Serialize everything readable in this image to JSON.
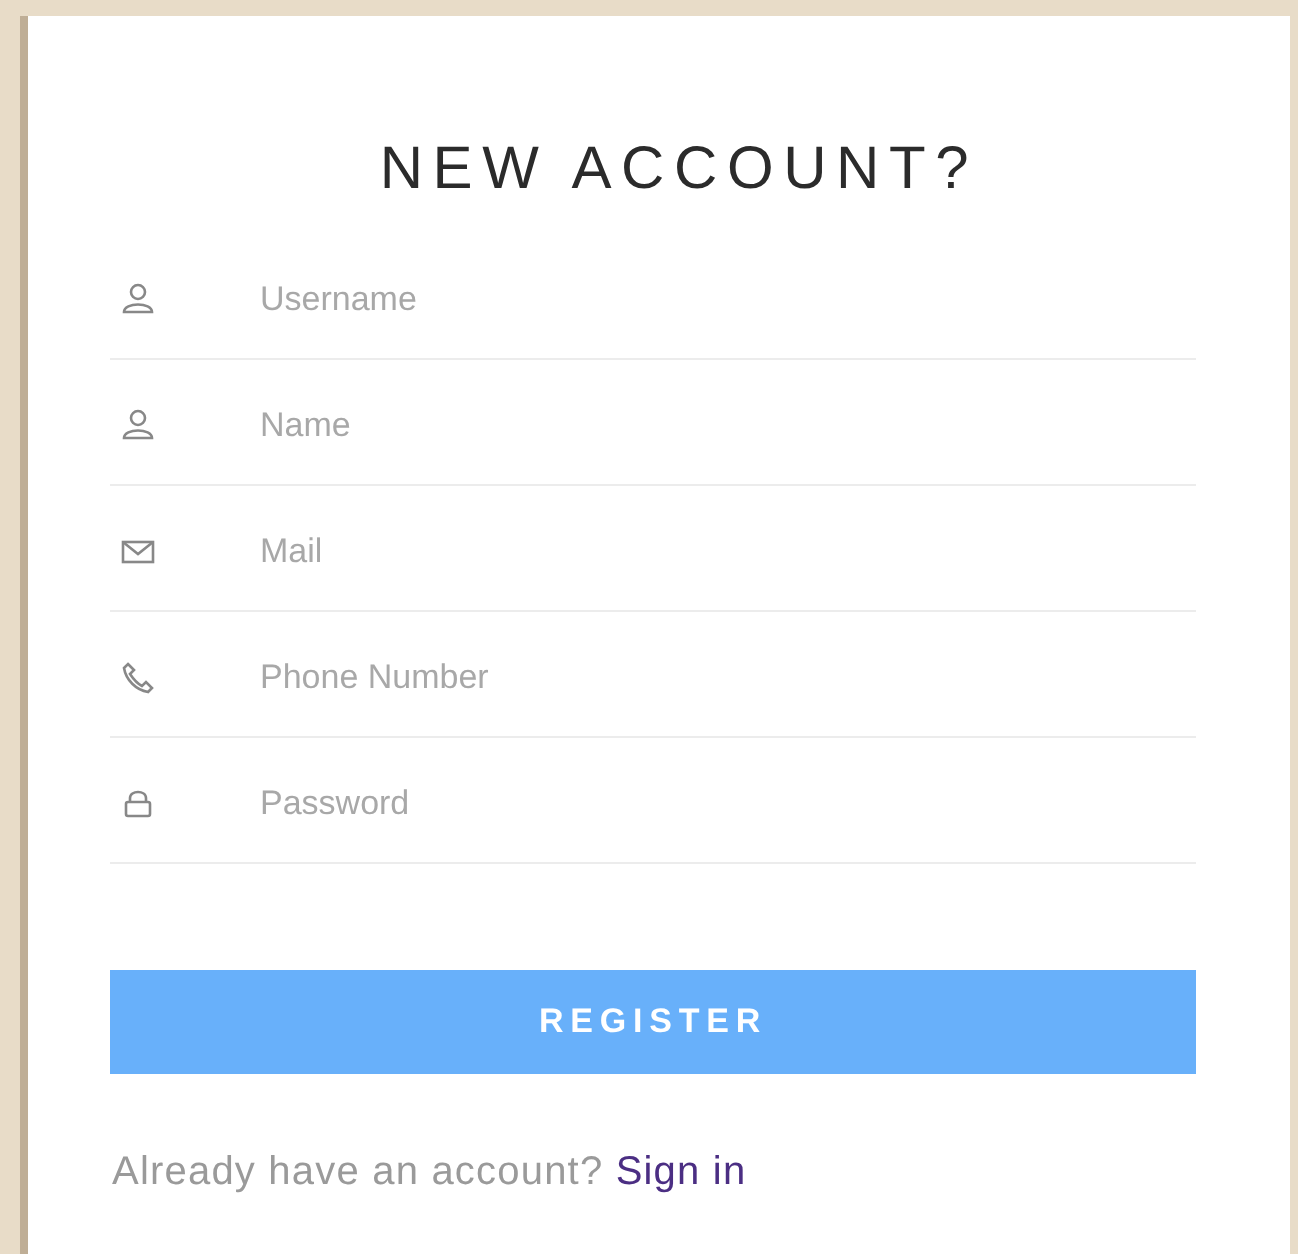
{
  "title": "NEW ACCOUNT?",
  "fields": [
    {
      "kind": "user",
      "placeholder": "Username"
    },
    {
      "kind": "user",
      "placeholder": "Name"
    },
    {
      "kind": "mail",
      "placeholder": "Mail"
    },
    {
      "kind": "phone",
      "placeholder": "Phone Number"
    },
    {
      "kind": "lock",
      "placeholder": "Password"
    }
  ],
  "button": "REGISTER",
  "footer": {
    "text": "Already have an account?",
    "link": "Sign in"
  }
}
